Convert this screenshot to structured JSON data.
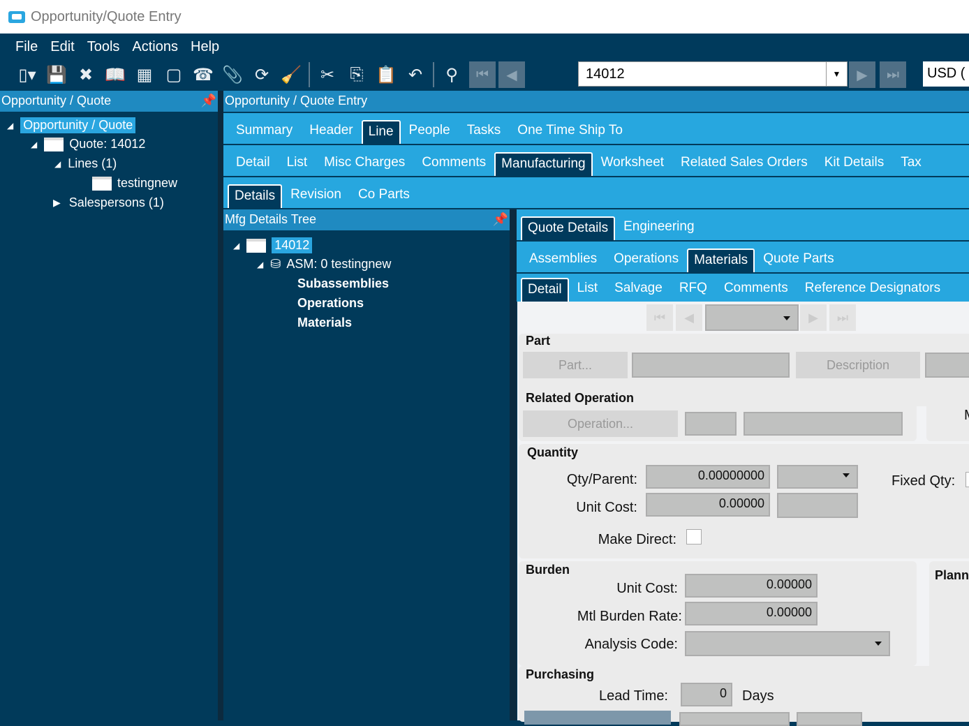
{
  "window": {
    "title": "Opportunity/Quote Entry"
  },
  "menu": [
    "File",
    "Edit",
    "Tools",
    "Actions",
    "Help"
  ],
  "toolbar": {
    "icons": [
      "new-icon",
      "save-icon",
      "delete-icon",
      "book-icon",
      "grid-icon",
      "note-icon",
      "phone-icon",
      "attach-icon",
      "refresh-icon",
      "clear-icon",
      "cut-icon",
      "copy-icon",
      "paste-icon",
      "undo-icon",
      "binoculars-icon",
      "first-icon",
      "prev-icon",
      "next-icon",
      "last-icon"
    ],
    "quote_number": "14012",
    "currency": "USD ("
  },
  "left_panel": {
    "title": "Opportunity / Quote",
    "tree": [
      "Opportunity / Quote",
      "Quote: 14012",
      "Lines (1)",
      "testingnew",
      "Salespersons (1)"
    ]
  },
  "main": {
    "title": "Opportunity / Quote Entry",
    "tabs1": [
      "Summary",
      "Header",
      "Line",
      "People",
      "Tasks",
      "One Time Ship To"
    ],
    "tabs1_active": "Line",
    "tabs2": [
      "Detail",
      "List",
      "Misc Charges",
      "Comments",
      "Manufacturing",
      "Worksheet",
      "Related Sales Orders",
      "Kit Details",
      "Tax"
    ],
    "tabs2_active": "Manufacturing",
    "tabs3": [
      "Details",
      "Revision",
      "Co Parts"
    ],
    "tabs3_active": "Details"
  },
  "mfg_tree": {
    "title": "Mfg Details Tree",
    "root": "14012",
    "asm": "ASM: 0 testingnew",
    "children": [
      "Subassemblies",
      "Operations",
      "Materials"
    ]
  },
  "detail": {
    "tabs1": [
      "Quote Details",
      "Engineering"
    ],
    "tabs2": [
      "Assemblies",
      "Operations",
      "Materials",
      "Quote Parts"
    ],
    "tabs3": [
      "Detail",
      "List",
      "Salvage",
      "RFQ",
      "Comments",
      "Reference Designators"
    ]
  },
  "form": {
    "part": {
      "title": "Part",
      "part_btn": "Part...",
      "desc_btn": "Description"
    },
    "related_operation": {
      "title": "Related Operation",
      "op_btn": "Operation...",
      "side_letter": "M"
    },
    "quantity": {
      "title": "Quantity",
      "qty_label": "Qty/Parent:",
      "qty_value": "0.00000000",
      "unit_cost_label": "Unit Cost:",
      "unit_cost_value": "0.00000",
      "make_direct_label": "Make Direct:",
      "make_direct": false,
      "fixed_qty_label": "Fixed Qty:"
    },
    "burden": {
      "title": "Burden",
      "unit_cost_label": "Unit Cost:",
      "unit_cost_value": "0.00000",
      "rate_label": "Mtl  Burden Rate:",
      "rate_value": "0.00000",
      "analysis_label": "Analysis Code:",
      "plan_title": "Plann"
    },
    "purchasing": {
      "title": "Purchasing",
      "lead_label": "Lead Time:",
      "lead_value": "0",
      "days": "Days"
    }
  }
}
